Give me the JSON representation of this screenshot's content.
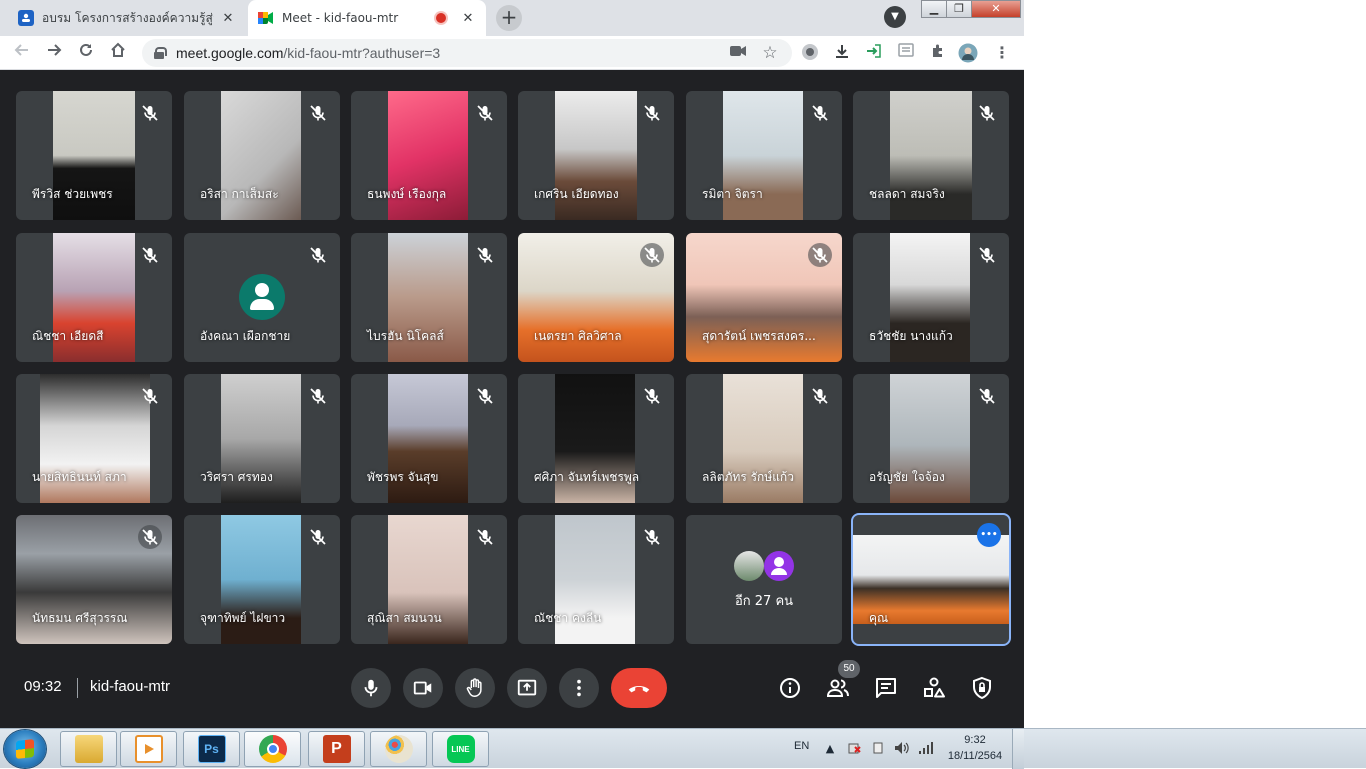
{
  "tabs": [
    {
      "title": "อบรม โครงการสร้างองค์ความรู้สู่อาชีพ",
      "favicon": "classroom-icon",
      "active": false
    },
    {
      "title": "Meet - kid-faou-mtr",
      "favicon": "meet-icon",
      "active": true
    }
  ],
  "omnibox": {
    "host": "meet.google.com",
    "path": "/kid-faou-mtr?authuser=3"
  },
  "participants": [
    {
      "name": "พีรวิส ช่วยเพชร",
      "muted": true
    },
    {
      "name": "อริสา กาเส็มสะ",
      "muted": true
    },
    {
      "name": "ธนพงษ์ เรืองกุล",
      "muted": true
    },
    {
      "name": "เกศริน เอียดทอง",
      "muted": true
    },
    {
      "name": "รมิตา จิตรา",
      "muted": true
    },
    {
      "name": "ชลลดา สมจริง",
      "muted": true
    },
    {
      "name": "ณิชชา เอียดสี",
      "muted": true
    },
    {
      "name": "อังคณา เผือกชาย",
      "muted": true
    },
    {
      "name": "ไบรฮัน นิโคลส์",
      "muted": true
    },
    {
      "name": "เนตรยา ศิลวิศาล",
      "muted": true
    },
    {
      "name": "สุดารัตน์ เพชรสงคร...",
      "muted": true
    },
    {
      "name": "ธวัชชัย นางแก้ว",
      "muted": true
    },
    {
      "name": "นายสิทธินนท์ สภา",
      "muted": true
    },
    {
      "name": "วริศรา ศรทอง",
      "muted": true
    },
    {
      "name": "พัชรพร จันสุข",
      "muted": true
    },
    {
      "name": "ศศิภา จันทร์เพชรพูล",
      "muted": true
    },
    {
      "name": "ลลิตภัทร รักษ์แก้ว",
      "muted": true
    },
    {
      "name": "อรัญชัย ใจจ้อง",
      "muted": true
    },
    {
      "name": "นัทธมน ศรีสุวรรณ",
      "muted": true
    },
    {
      "name": "จุฑาทิพย์ ไฝขาว",
      "muted": true
    },
    {
      "name": "สุณิสา สมนวน",
      "muted": true
    },
    {
      "name": "ณัชชา คงลีน",
      "muted": true
    }
  ],
  "others_tile": {
    "label": "อีก 27 คน"
  },
  "self_tile": {
    "name": "คุณ"
  },
  "meeting": {
    "time": "09:32",
    "code": "kid-faou-mtr",
    "people_count": "50"
  },
  "colors": {
    "meet_bg": "#202124",
    "tile_bg": "#3c4043",
    "end_call": "#ea4335",
    "accent": "#1a73e8"
  },
  "controls": [
    "mic-icon",
    "camera-icon",
    "raise-hand-icon",
    "present-screen-icon",
    "more-options-icon",
    "end-call-icon"
  ],
  "right_controls": [
    "info-icon",
    "people-icon",
    "chat-icon",
    "activities-icon",
    "host-controls-icon"
  ],
  "taskbar": {
    "apps": [
      "file-explorer-icon",
      "media-player-icon",
      "photoshop-icon",
      "chrome-icon",
      "powerpoint-icon",
      "paint-icon",
      "line-icon"
    ],
    "app_labels": {
      "photoshop": "Ps",
      "powerpoint": "P",
      "line": "LINE"
    },
    "lang": "EN",
    "clock_time": "9:32",
    "clock_date": "18/11/2564"
  }
}
